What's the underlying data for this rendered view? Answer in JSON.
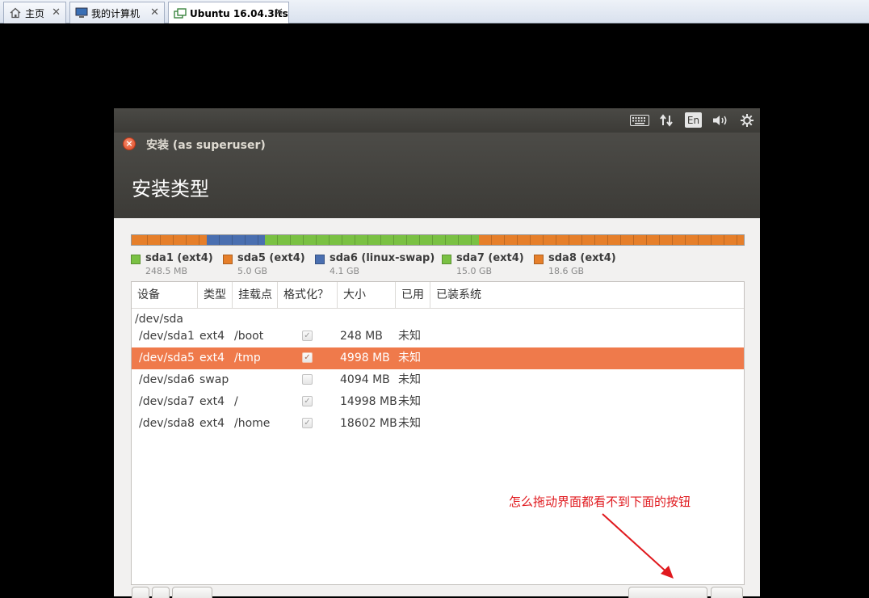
{
  "tabs": [
    {
      "label": "主页",
      "icon": "home-icon",
      "active": false
    },
    {
      "label": "我的计算机",
      "icon": "computer-icon",
      "active": false
    },
    {
      "label": "Ubuntu 16.04.3lts",
      "icon": "vm-icon",
      "active": true
    }
  ],
  "tab_close_glyph": "✕",
  "panel": {
    "icons": [
      "keyboard-icon",
      "network-transfer-icon",
      "keyboard-layout-indicator",
      "volume-icon",
      "settings-gear-icon"
    ],
    "keyboard_layout": "En"
  },
  "window": {
    "title": "安装 (as superuser)",
    "close_glyph": "×",
    "heading": "安装类型"
  },
  "partition_bar": {
    "colors": {
      "ext4": "#e67f2a",
      "swap": "#4a6fb0",
      "root": "#7ac143"
    },
    "segments": [
      {
        "name": "sda1",
        "color": "#e67f2a",
        "size_mb": 248
      },
      {
        "name": "sda5",
        "color": "#e67f2a",
        "size_mb": 4998
      },
      {
        "name": "sda6",
        "color": "#4a6fb0",
        "size_mb": 4094
      },
      {
        "name": "sda7",
        "color": "#7ac143",
        "size_mb": 14998
      },
      {
        "name": "sda8",
        "color": "#e67f2a",
        "size_mb": 18602
      }
    ]
  },
  "legend": [
    {
      "name": "sda1 (ext4)",
      "size": "248.5 MB",
      "color": "#7ac143"
    },
    {
      "name": "sda5 (ext4)",
      "size": "5.0 GB",
      "color": "#e67f2a"
    },
    {
      "name": "sda6 (linux-swap)",
      "size": "4.1 GB",
      "color": "#4a6fb0"
    },
    {
      "name": "sda7 (ext4)",
      "size": "15.0 GB",
      "color": "#7ac143"
    },
    {
      "name": "sda8 (ext4)",
      "size": "18.6 GB",
      "color": "#e67f2a"
    }
  ],
  "table": {
    "headers": [
      "设备",
      "类型",
      "挂载点",
      "格式化？",
      "大小",
      "已用",
      "已装系统"
    ],
    "disk": "/dev/sda",
    "rows": [
      {
        "device": "/dev/sda1",
        "type": "ext4",
        "mount": "/boot",
        "format": "✓",
        "size": "248 MB",
        "used": "未知",
        "system": "",
        "selected": false
      },
      {
        "device": "/dev/sda5",
        "type": "ext4",
        "mount": "/tmp",
        "format": "✓",
        "size": "4998 MB",
        "used": "未知",
        "system": "",
        "selected": true
      },
      {
        "device": "/dev/sda6",
        "type": "swap",
        "mount": "",
        "format": "",
        "size": "4094 MB",
        "used": "未知",
        "system": "",
        "selected": false
      },
      {
        "device": "/dev/sda7",
        "type": "ext4",
        "mount": "/",
        "format": "✓",
        "size": "14998 MB",
        "used": "未知",
        "system": "",
        "selected": false
      },
      {
        "device": "/dev/sda8",
        "type": "ext4",
        "mount": "/home",
        "format": "✓",
        "size": "18602 MB",
        "used": "未知",
        "system": "",
        "selected": false
      }
    ]
  },
  "annotation": {
    "text": "怎么拖动界面都看不到下面的按钮",
    "color": "#e0191e"
  }
}
